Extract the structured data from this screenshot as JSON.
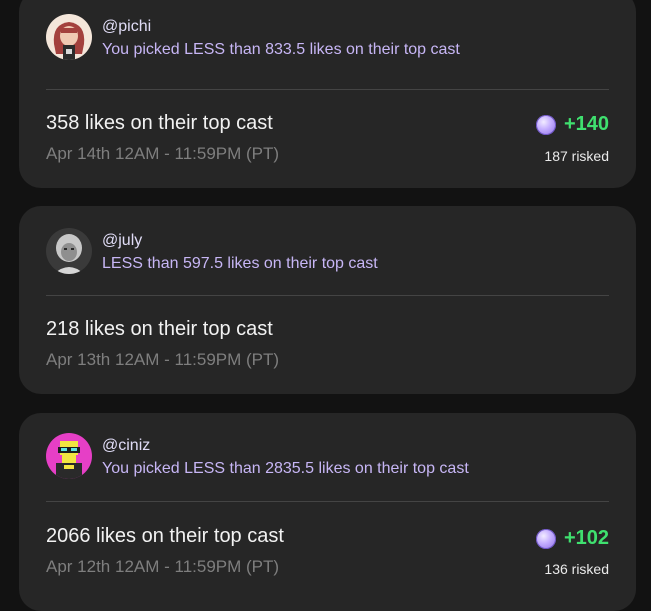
{
  "cards": [
    {
      "username": "@pichi",
      "pick_text": "You picked LESS than 833.5 likes on their top cast",
      "result": "358 likes on their top cast",
      "date_range": "Apr 14th 12AM - 11:59PM (PT)",
      "reward_points": "+140",
      "risked_text": "187 risked",
      "avatar_icon": "pink-haired-character-avatar"
    },
    {
      "username": "@july",
      "pick_text": "LESS than 597.5 likes on their top cast",
      "result": "218 likes on their top cast",
      "date_range": "Apr 13th 12AM - 11:59PM (PT)",
      "avatar_icon": "grayscale-portrait-avatar"
    },
    {
      "username": "@ciniz",
      "pick_text": "You picked LESS than 2835.5 likes on their top cast",
      "result": "2066 likes on their top cast",
      "date_range": "Apr 12th 12AM - 11:59PM (PT)",
      "reward_points": "+102",
      "risked_text": "136 risked",
      "avatar_icon": "pixel-character-avatar"
    }
  ],
  "colors": {
    "background": "#121212",
    "card": "#262626",
    "pick_text": "#c7b6f5",
    "reward_green": "#3fe06f",
    "coin_purple": "#c6b0ff"
  }
}
